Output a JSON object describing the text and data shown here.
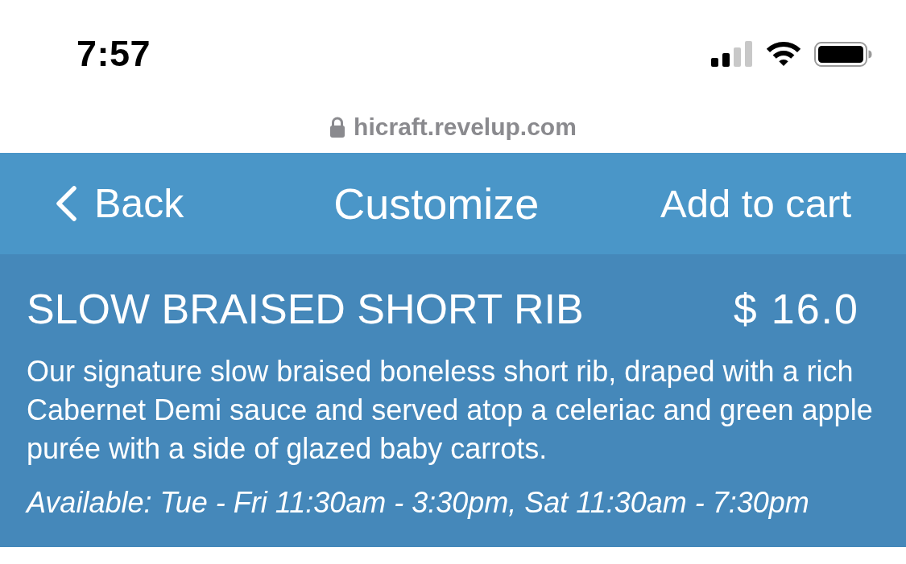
{
  "status_bar": {
    "time": "7:57"
  },
  "address_bar": {
    "url": "hicraft.revelup.com"
  },
  "nav_bar": {
    "back": "Back",
    "title": "Customize",
    "action": "Add to cart"
  },
  "item": {
    "name": "SLOW BRAISED SHORT RIB",
    "currency": "$",
    "price": "16.0",
    "description": "Our signature slow braised boneless short rib, draped with a rich Cabernet Demi sauce and served atop a celeriac and green apple purée with a side of glazed baby carrots.",
    "availability": "Available: Tue - Fri 11:30am - 3:30pm, Sat 11:30am - 7:30pm"
  }
}
